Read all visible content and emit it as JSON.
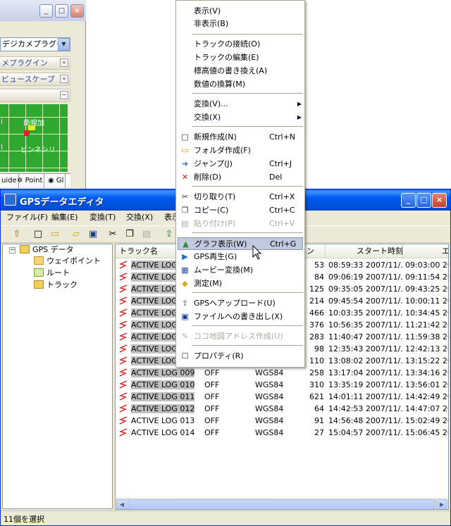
{
  "bg_window": {
    "select_value": "デジカメプラグイ",
    "panels": [
      "メプラグイン",
      "ビュースケープ",
      ""
    ],
    "map_labels": [
      "南幌加",
      "ビンネシリ",
      "I",
      "I"
    ],
    "tabs": [
      "uide",
      "Point",
      "Gl"
    ]
  },
  "main": {
    "title": "GPSデータエディタ",
    "menu": [
      "ファイル(F)",
      "編集(E)",
      "変換(T)",
      "交換(X)",
      "表示"
    ],
    "tree": {
      "root": "GPS データ",
      "children": [
        "ウェイポイント",
        "ルート",
        "トラック"
      ]
    },
    "columns": [
      "トラック名",
      "",
      "",
      "ン",
      "スタート時刻",
      "エ"
    ],
    "rows": [
      {
        "name": "ACTIVE LOG 001",
        "c2": "",
        "c3": "",
        "n": "53",
        "start": "08:59:33 2007/11/...",
        "end": "09:03:00 200"
      },
      {
        "name": "ACTIVE LOG 002",
        "c2": "",
        "c3": "",
        "n": "84",
        "start": "09:06:19 2007/11/...",
        "end": "09:11:54 200"
      },
      {
        "name": "ACTIVE LOG 003",
        "c2": "",
        "c3": "",
        "n": "125",
        "start": "09:35:05 2007/11/...",
        "end": "09:43:25 200"
      },
      {
        "name": "ACTIVE LOG 004",
        "c2": "",
        "c3": "",
        "n": "214",
        "start": "09:45:54 2007/11/...",
        "end": "10:00:11 200"
      },
      {
        "name": "ACTIVE LOG 005",
        "c2": "",
        "c3": "",
        "n": "466",
        "start": "10:03:35 2007/11/...",
        "end": "10:34:45 200"
      },
      {
        "name": "ACTIVE LOG 006",
        "c2": "",
        "c3": "",
        "n": "376",
        "start": "10:56:35 2007/11/...",
        "end": "11:21:42 200"
      },
      {
        "name": "ACTIVE LOG 007",
        "c2": "",
        "c3": "",
        "n": "283",
        "start": "11:40:47 2007/11/...",
        "end": "11:59:38 200"
      },
      {
        "name": "ACTIVE LOG 008",
        "c2": "",
        "c3": "",
        "n": "98",
        "start": "12:35:43 2007/11/...",
        "end": "12:42:13 200"
      },
      {
        "name": "ACTIVE LOG 008",
        "c2": "",
        "c3": "",
        "n": "110",
        "start": "13:08:02 2007/11/...",
        "end": "13:15:22 200"
      },
      {
        "name": "ACTIVE LOG 009",
        "c2": "OFF",
        "c3": "WGS84",
        "n": "258",
        "start": "13:17:04 2007/11/...",
        "end": "13:34:16 200"
      },
      {
        "name": "ACTIVE LOG 010",
        "c2": "OFF",
        "c3": "WGS84",
        "n": "310",
        "start": "13:35:19 2007/11/...",
        "end": "13:56:01 200"
      },
      {
        "name": "ACTIVE LOG 011",
        "c2": "OFF",
        "c3": "WGS84",
        "n": "621",
        "start": "14:01:11 2007/11/...",
        "end": "14:42:49 200"
      },
      {
        "name": "ACTIVE LOG 012",
        "c2": "OFF",
        "c3": "WGS84",
        "n": "64",
        "start": "14:42:53 2007/11/...",
        "end": "14:47:07 200"
      },
      {
        "name": "ACTIVE LOG 013",
        "c2": "OFF",
        "c3": "WGS84",
        "n": "91",
        "start": "14:56:48 2007/11/...",
        "end": "15:02:49 200"
      },
      {
        "name": "ACTIVE LOG 014",
        "c2": "OFF",
        "c3": "WGS84",
        "n": "27",
        "start": "15:04:57 2007/11/...",
        "end": "15:06:45 200"
      }
    ],
    "status": "11個を選択"
  },
  "context_menu": {
    "items": [
      {
        "label": "表示(V)",
        "shortcut": "",
        "icon": "",
        "disabled": false,
        "arrow": false,
        "highlight": false
      },
      {
        "label": "非表示(B)",
        "shortcut": "",
        "icon": "",
        "disabled": false,
        "arrow": false,
        "highlight": false
      },
      {
        "label": "トラックの接続(O)",
        "shortcut": "",
        "icon": "",
        "disabled": false,
        "arrow": false,
        "highlight": false
      },
      {
        "label": "トラックの編集(E)",
        "shortcut": "",
        "icon": "",
        "disabled": false,
        "arrow": false,
        "highlight": false
      },
      {
        "label": "標高値の書き換え(A)",
        "shortcut": "",
        "icon": "",
        "disabled": false,
        "arrow": false,
        "highlight": false
      },
      {
        "label": "数値の換算(M)",
        "shortcut": "",
        "icon": "",
        "disabled": false,
        "arrow": false,
        "highlight": false
      },
      {
        "label": "変換(V)...",
        "shortcut": "",
        "icon": "",
        "disabled": false,
        "arrow": true,
        "highlight": false
      },
      {
        "label": "交換(X)",
        "shortcut": "",
        "icon": "",
        "disabled": false,
        "arrow": true,
        "highlight": false
      },
      {
        "label": "新規作成(N)",
        "shortcut": "Ctrl+N",
        "icon": "new-document-icon",
        "disabled": false,
        "arrow": false,
        "highlight": false
      },
      {
        "label": "フォルダ作成(F)",
        "shortcut": "",
        "icon": "folder-icon",
        "disabled": false,
        "arrow": false,
        "highlight": false
      },
      {
        "label": "ジャンプ(J)",
        "shortcut": "Ctrl+J",
        "icon": "jump-icon",
        "disabled": false,
        "arrow": false,
        "highlight": false
      },
      {
        "label": "削除(D)",
        "shortcut": "Del",
        "icon": "delete-icon",
        "disabled": false,
        "arrow": false,
        "highlight": false
      },
      {
        "label": "切り取り(T)",
        "shortcut": "Ctrl+X",
        "icon": "scissors-icon",
        "disabled": false,
        "arrow": false,
        "highlight": false
      },
      {
        "label": "コピー(C)",
        "shortcut": "Ctrl+C",
        "icon": "copy-icon",
        "disabled": false,
        "arrow": false,
        "highlight": false
      },
      {
        "label": "貼り付け(P)",
        "shortcut": "Ctrl+V",
        "icon": "paste-icon",
        "disabled": true,
        "arrow": false,
        "highlight": false
      },
      {
        "label": "グラフ表示(W)",
        "shortcut": "Ctrl+G",
        "icon": "graph-icon",
        "disabled": false,
        "arrow": false,
        "highlight": true
      },
      {
        "label": "GPS再生(G)",
        "shortcut": "",
        "icon": "gps-play-icon",
        "disabled": false,
        "arrow": false,
        "highlight": false
      },
      {
        "label": "ムービー変換(M)",
        "shortcut": "",
        "icon": "movie-icon",
        "disabled": false,
        "arrow": false,
        "highlight": false
      },
      {
        "label": "測定(M)",
        "shortcut": "",
        "icon": "ruler-icon",
        "disabled": false,
        "arrow": false,
        "highlight": false
      },
      {
        "label": "GPSへアップロード(U)",
        "shortcut": "",
        "icon": "upload-icon",
        "disabled": false,
        "arrow": false,
        "highlight": false
      },
      {
        "label": "ファイルへの書き出し(X)",
        "shortcut": "",
        "icon": "save-icon",
        "disabled": false,
        "arrow": false,
        "highlight": false
      },
      {
        "label": "ココ地図アドレス作成(U)",
        "shortcut": "",
        "icon": "map-address-icon",
        "disabled": true,
        "arrow": false,
        "highlight": false
      },
      {
        "label": "プロパティ(R)",
        "shortcut": "",
        "icon": "properties-icon",
        "disabled": false,
        "arrow": false,
        "highlight": false
      }
    ]
  }
}
